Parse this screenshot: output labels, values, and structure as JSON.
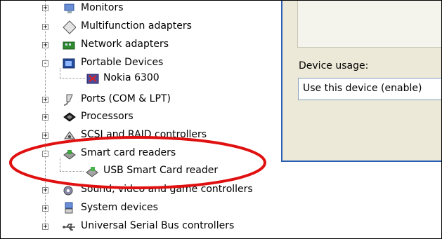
{
  "tree": {
    "items": [
      {
        "label": "Monitors",
        "icon": "monitor-icon",
        "expander": "+"
      },
      {
        "label": "Multifunction adapters",
        "icon": "multifunction-adapter-icon",
        "expander": "+"
      },
      {
        "label": "Network adapters",
        "icon": "network-adapter-icon",
        "expander": "+"
      },
      {
        "label": "Portable Devices",
        "icon": "portable-device-icon",
        "expander": "-"
      },
      {
        "label": "Nokia 6300",
        "icon": "phone-device-icon"
      },
      {
        "label": "Ports (COM & LPT)",
        "icon": "port-icon",
        "expander": "+"
      },
      {
        "label": "Processors",
        "icon": "processor-icon",
        "expander": "+"
      },
      {
        "label": "SCSI and RAID controllers",
        "icon": "scsi-controller-icon",
        "expander": "+"
      },
      {
        "label": "Smart card readers",
        "icon": "smart-card-reader-icon",
        "expander": "-"
      },
      {
        "label": "USB Smart Card reader",
        "icon": "usb-smart-card-reader-icon"
      },
      {
        "label": "Sound, video and game controllers",
        "icon": "sound-icon",
        "expander": "+"
      },
      {
        "label": "System devices",
        "icon": "system-device-icon",
        "expander": "+"
      },
      {
        "label": "Universal Serial Bus controllers",
        "icon": "usb-icon",
        "expander": "+"
      }
    ]
  },
  "properties": {
    "device_usage_label": "Device usage:",
    "device_usage_value": "Use this device (enable)"
  },
  "colors": {
    "highlight": "#e01010",
    "panel_border": "#2b5fb3",
    "panel_bg": "#ece9d8"
  }
}
